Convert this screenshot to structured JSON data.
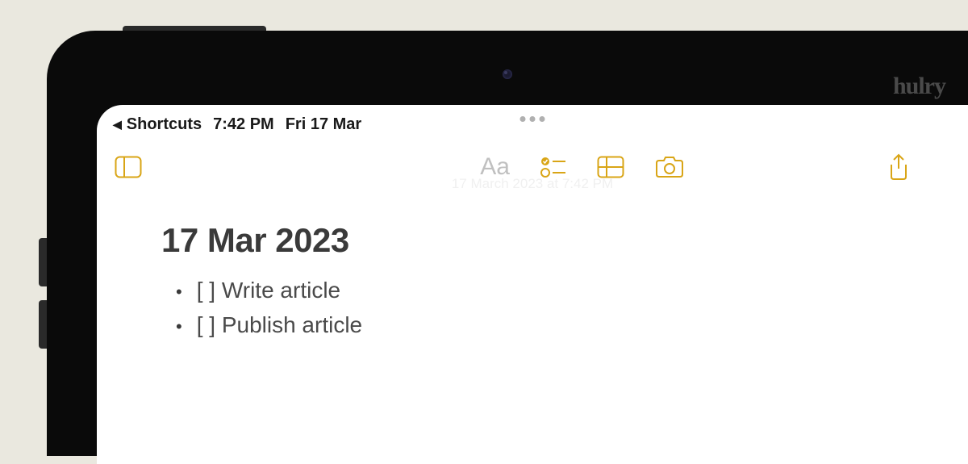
{
  "watermark": "hulry",
  "status_bar": {
    "back_app": "Shortcuts",
    "time": "7:42 PM",
    "date": "Fri 17 Mar"
  },
  "toolbar": {
    "sidebar_icon": "sidebar-icon",
    "format_label": "Aa",
    "checklist_icon": "checklist-icon",
    "table_icon": "table-icon",
    "camera_icon": "camera-icon",
    "share_icon": "share-icon"
  },
  "note": {
    "timestamp": "17 March 2023 at 7:42 PM",
    "title": "17 Mar 2023",
    "items": [
      "[ ] Write article",
      "[ ] Publish article"
    ]
  },
  "accent_color": "#d9a516"
}
